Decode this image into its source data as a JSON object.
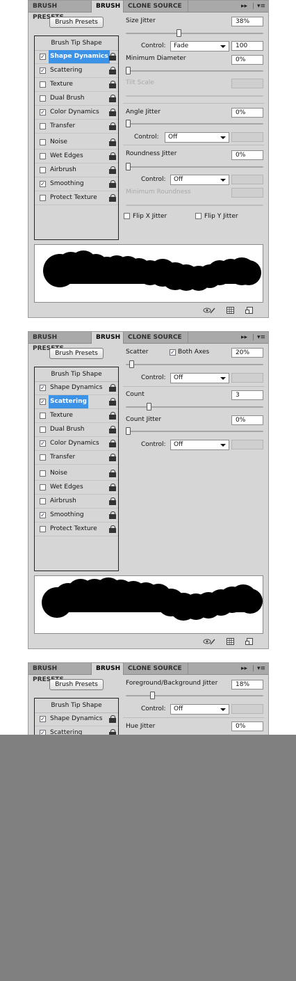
{
  "panels": [
    {
      "tabs": [
        "BRUSH PRESETS",
        "BRUSH",
        "CLONE SOURCE"
      ],
      "menu_glyphs": [
        "▸▸",
        "|",
        "▾≡"
      ],
      "presets_button": "Brush Presets",
      "tip_shape": "Brush Tip Shape",
      "options": [
        {
          "label": "Shape Dynamics",
          "checked": true,
          "selected": true
        },
        {
          "label": "Scattering",
          "checked": true
        },
        {
          "label": "Texture",
          "checked": false
        },
        {
          "label": "Dual Brush",
          "checked": false
        },
        {
          "label": "Color Dynamics",
          "checked": true
        },
        {
          "label": "Transfer",
          "checked": false
        },
        {
          "label": "Noise",
          "checked": false
        },
        {
          "label": "Wet Edges",
          "checked": false
        },
        {
          "label": "Airbrush",
          "checked": false
        },
        {
          "label": "Smoothing",
          "checked": true
        },
        {
          "label": "Protect Texture",
          "checked": false
        }
      ],
      "settings": {
        "size_jitter_label": "Size Jitter",
        "size_jitter_value": "38%",
        "size_jitter_level": 0.38,
        "control_label": "Control:",
        "size_control": "Fade",
        "fade_steps": "100",
        "min_diameter_label": "Minimum Diameter",
        "min_diameter_value": "0%",
        "tilt_scale_label": "Tilt Scale",
        "angle_jitter_label": "Angle Jitter",
        "angle_jitter_value": "0%",
        "angle_control": "Off",
        "roundness_jitter_label": "Roundness Jitter",
        "roundness_jitter_value": "0%",
        "roundness_control": "Off",
        "min_roundness_label": "Minimum Roundness",
        "flip_x_label": "Flip X Jitter",
        "flip_y_label": "Flip Y Jitter"
      }
    },
    {
      "tabs": [
        "BRUSH PRESETS",
        "BRUSH",
        "CLONE SOURCE"
      ],
      "menu_glyphs": [
        "▸▸",
        "|",
        "▾≡"
      ],
      "presets_button": "Brush Presets",
      "tip_shape": "Brush Tip Shape",
      "options": [
        {
          "label": "Shape Dynamics",
          "checked": true
        },
        {
          "label": "Scattering",
          "checked": true,
          "selected": true
        },
        {
          "label": "Texture",
          "checked": false
        },
        {
          "label": "Dual Brush",
          "checked": false
        },
        {
          "label": "Color Dynamics",
          "checked": true
        },
        {
          "label": "Transfer",
          "checked": false
        },
        {
          "label": "Noise",
          "checked": false
        },
        {
          "label": "Wet Edges",
          "checked": false
        },
        {
          "label": "Airbrush",
          "checked": false
        },
        {
          "label": "Smoothing",
          "checked": true
        },
        {
          "label": "Protect Texture",
          "checked": false
        }
      ],
      "settings": {
        "scatter_label": "Scatter",
        "both_axes_label": "Both Axes",
        "scatter_value": "20%",
        "scatter_level": 0.02,
        "control_label": "Control:",
        "scatter_control": "Off",
        "count_label": "Count",
        "count_value": "3",
        "count_level": 0.15,
        "count_jitter_label": "Count Jitter",
        "count_jitter_value": "0%",
        "count_control": "Off"
      }
    },
    {
      "tabs": [
        "BRUSH PRESETS",
        "BRUSH",
        "CLONE SOURCE"
      ],
      "menu_glyphs": [
        "▸▸",
        "|",
        "▾≡"
      ],
      "presets_button": "Brush Presets",
      "tip_shape": "Brush Tip Shape",
      "options": [
        {
          "label": "Shape Dynamics",
          "checked": true
        },
        {
          "label": "Scattering",
          "checked": true
        }
      ],
      "settings": {
        "fg_bg_label": "Foreground/Background Jitter",
        "fg_bg_value": "18%",
        "fg_bg_level": 0.18,
        "control_label": "Control:",
        "fg_bg_control": "Off",
        "hue_jitter_label": "Hue Jitter",
        "hue_jitter_value": "0%"
      }
    }
  ]
}
